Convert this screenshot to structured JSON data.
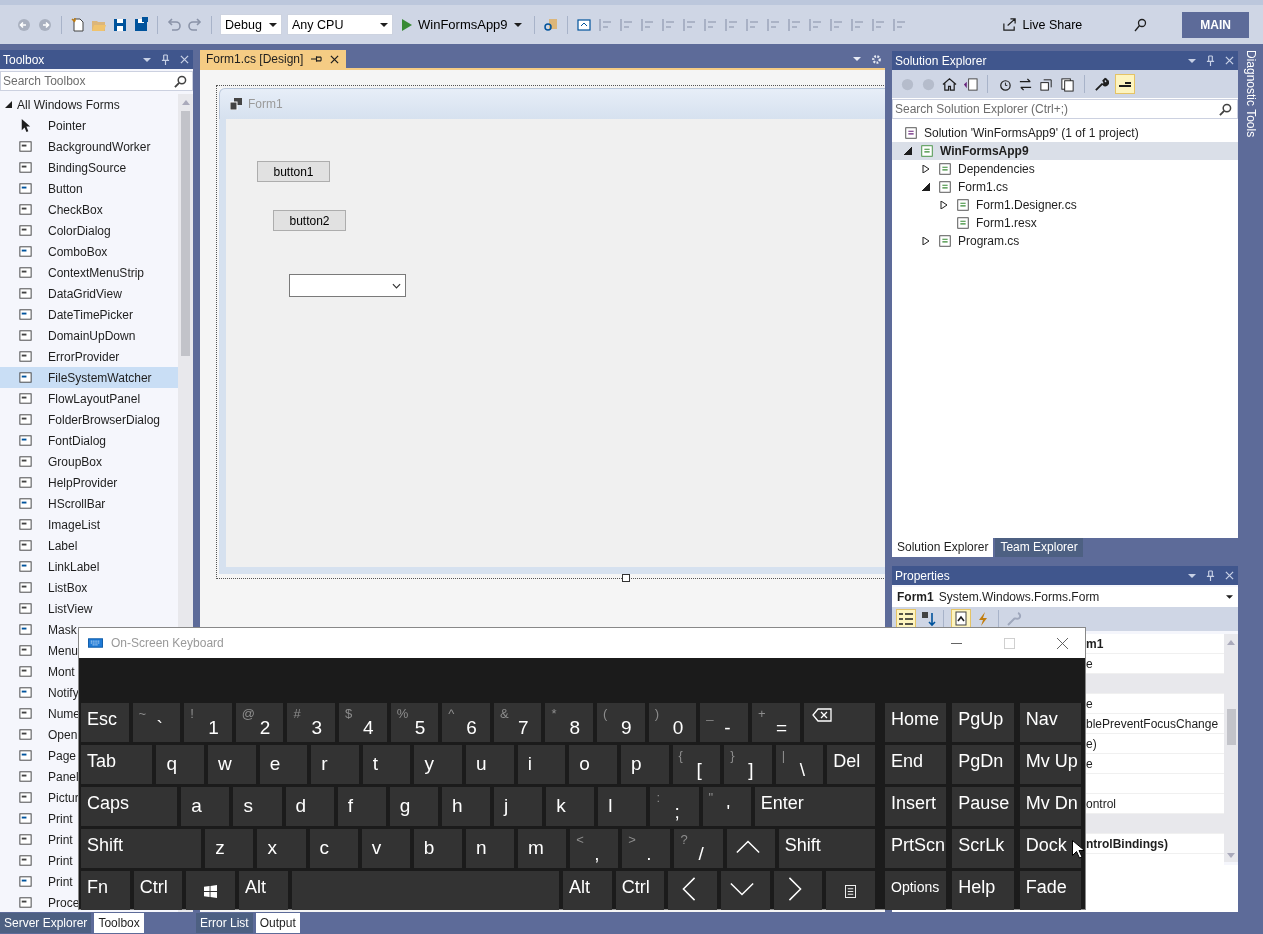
{
  "toolbar": {
    "configuration": "Debug",
    "platform": "Any CPU",
    "start_target": "WinFormsApp9",
    "live_share": "Live Share",
    "branch_badge": "MAIN"
  },
  "toolbox": {
    "title": "Toolbox",
    "search": {
      "placeholder": "Search Toolbox"
    },
    "group": {
      "label": "All Windows Forms",
      "expanded": true
    },
    "items": [
      {
        "label": "Pointer",
        "selected": false
      },
      {
        "label": "BackgroundWorker",
        "selected": false
      },
      {
        "label": "BindingSource",
        "selected": false
      },
      {
        "label": "Button",
        "selected": false
      },
      {
        "label": "CheckBox",
        "selected": false
      },
      {
        "label": "ColorDialog",
        "selected": false
      },
      {
        "label": "ComboBox",
        "selected": false
      },
      {
        "label": "ContextMenuStrip",
        "selected": false
      },
      {
        "label": "DataGridView",
        "selected": false
      },
      {
        "label": "DateTimePicker",
        "selected": false
      },
      {
        "label": "DomainUpDown",
        "selected": false
      },
      {
        "label": "ErrorProvider",
        "selected": false
      },
      {
        "label": "FileSystemWatcher",
        "selected": true
      },
      {
        "label": "FlowLayoutPanel",
        "selected": false
      },
      {
        "label": "FolderBrowserDialog",
        "selected": false
      },
      {
        "label": "FontDialog",
        "selected": false
      },
      {
        "label": "GroupBox",
        "selected": false
      },
      {
        "label": "HelpProvider",
        "selected": false
      },
      {
        "label": "HScrollBar",
        "selected": false
      },
      {
        "label": "ImageList",
        "selected": false
      },
      {
        "label": "Label",
        "selected": false
      },
      {
        "label": "LinkLabel",
        "selected": false
      },
      {
        "label": "ListBox",
        "selected": false
      },
      {
        "label": "ListView",
        "selected": false
      },
      {
        "label": "Mask",
        "selected": false
      },
      {
        "label": "Menu",
        "selected": false
      },
      {
        "label": "Mont",
        "selected": false
      },
      {
        "label": "Notify",
        "selected": false
      },
      {
        "label": "Nume",
        "selected": false
      },
      {
        "label": "Open",
        "selected": false
      },
      {
        "label": "Page",
        "selected": false
      },
      {
        "label": "Panel",
        "selected": false
      },
      {
        "label": "Pictur",
        "selected": false
      },
      {
        "label": "Print",
        "selected": false
      },
      {
        "label": "Print",
        "selected": false
      },
      {
        "label": "Print",
        "selected": false
      },
      {
        "label": "Print",
        "selected": false
      },
      {
        "label": "Proce",
        "selected": false
      }
    ]
  },
  "editor": {
    "tabs": [
      {
        "label": "Form1.cs [Design]",
        "selected": true
      }
    ],
    "form": {
      "title": "Form1",
      "controls": [
        {
          "kind": "button",
          "text": "button1"
        },
        {
          "kind": "button",
          "text": "button2"
        },
        {
          "kind": "combobox"
        }
      ]
    }
  },
  "solution_explorer": {
    "title": "Solution Explorer",
    "search": {
      "placeholder": "Search Solution Explorer (Ctrl+;)"
    },
    "tree": [
      {
        "label": "Solution 'WinFormsApp9' (1 of 1 project)",
        "selected": false,
        "bold": false,
        "children": [
          {
            "label": "WinFormsApp9",
            "selected": true,
            "bold": true,
            "expanded": true,
            "children": [
              {
                "label": "Dependencies",
                "selected": false,
                "bold": false,
                "expanded": false
              },
              {
                "label": "Form1.cs",
                "selected": false,
                "bold": false,
                "expanded": true,
                "children": [
                  {
                    "label": "Form1.Designer.cs",
                    "selected": false,
                    "bold": false,
                    "expanded": false
                  },
                  {
                    "label": "Form1.resx",
                    "selected": false,
                    "bold": false
                  }
                ]
              },
              {
                "label": "Program.cs",
                "selected": false,
                "bold": false,
                "expanded": false
              }
            ]
          }
        ]
      }
    ],
    "tabs": [
      {
        "label": "Solution Explorer",
        "selected": true
      },
      {
        "label": "Team Explorer",
        "selected": false
      }
    ]
  },
  "diagnostic_tools": {
    "label": "Diagnostic Tools"
  },
  "properties": {
    "title": "Properties",
    "object_name": "Form1",
    "object_type": "System.Windows.Forms.Form",
    "rows": [
      {
        "kind": "property",
        "value": "m1",
        "bold": true
      },
      {
        "kind": "property",
        "value": "e",
        "bold": false
      },
      {
        "kind": "category"
      },
      {
        "kind": "property",
        "value": "e",
        "bold": false
      },
      {
        "kind": "property",
        "value": "blePreventFocusChange",
        "bold": false
      },
      {
        "kind": "property",
        "value": "e)",
        "bold": false
      },
      {
        "kind": "property",
        "value": "e",
        "bold": false
      },
      {
        "kind": "property"
      },
      {
        "kind": "property",
        "value": "ontrol",
        "bold": false
      },
      {
        "kind": "category"
      },
      {
        "kind": "property",
        "value": "ntrolBindings)",
        "bold": true
      },
      {
        "kind": "property"
      }
    ]
  },
  "keyboard": {
    "title": "On-Screen Keyboard",
    "main_rows": [
      [
        {
          "kind": "label",
          "label": "Esc"
        },
        {
          "kind": "char",
          "shift": "~",
          "label": "`"
        },
        {
          "kind": "char",
          "shift": "!",
          "label": "1"
        },
        {
          "kind": "char",
          "shift": "@",
          "label": "2"
        },
        {
          "kind": "char",
          "shift": "#",
          "label": "3"
        },
        {
          "kind": "char",
          "shift": "$",
          "label": "4"
        },
        {
          "kind": "char",
          "shift": "%",
          "label": "5"
        },
        {
          "kind": "char",
          "shift": "^",
          "label": "6"
        },
        {
          "kind": "char",
          "shift": "&",
          "label": "7"
        },
        {
          "kind": "char",
          "shift": "*",
          "label": "8"
        },
        {
          "kind": "char",
          "shift": "(",
          "label": "9"
        },
        {
          "kind": "char",
          "shift": ")",
          "label": "0"
        },
        {
          "kind": "char",
          "shift": "_",
          "label": "-"
        },
        {
          "kind": "char",
          "shift": "+",
          "label": "="
        },
        {
          "kind": "backspace"
        }
      ],
      [
        {
          "kind": "label",
          "label": "Tab"
        },
        {
          "kind": "letter",
          "label": "q"
        },
        {
          "kind": "letter",
          "label": "w"
        },
        {
          "kind": "letter",
          "label": "e"
        },
        {
          "kind": "letter",
          "label": "r"
        },
        {
          "kind": "letter",
          "label": "t"
        },
        {
          "kind": "letter",
          "label": "y"
        },
        {
          "kind": "letter",
          "label": "u"
        },
        {
          "kind": "letter",
          "label": "i"
        },
        {
          "kind": "letter",
          "label": "o"
        },
        {
          "kind": "letter",
          "label": "p"
        },
        {
          "kind": "char",
          "shift": "{",
          "label": "["
        },
        {
          "kind": "char",
          "shift": "}",
          "label": "]"
        },
        {
          "kind": "char",
          "shift": "|",
          "label": "\\"
        },
        {
          "kind": "label",
          "label": "Del"
        }
      ],
      [
        {
          "kind": "label",
          "label": "Caps"
        },
        {
          "kind": "letter",
          "label": "a"
        },
        {
          "kind": "letter",
          "label": "s"
        },
        {
          "kind": "letter",
          "label": "d"
        },
        {
          "kind": "letter",
          "label": "f"
        },
        {
          "kind": "letter",
          "label": "g"
        },
        {
          "kind": "letter",
          "label": "h"
        },
        {
          "kind": "letter",
          "label": "j"
        },
        {
          "kind": "letter",
          "label": "k"
        },
        {
          "kind": "letter",
          "label": "l"
        },
        {
          "kind": "char",
          "shift": ":",
          "label": ";"
        },
        {
          "kind": "char",
          "shift": "\"",
          "label": "'"
        },
        {
          "kind": "label",
          "label": "Enter"
        }
      ],
      [
        {
          "kind": "label",
          "label": "Shift"
        },
        {
          "kind": "letter",
          "label": "z"
        },
        {
          "kind": "letter",
          "label": "x"
        },
        {
          "kind": "letter",
          "label": "c"
        },
        {
          "kind": "letter",
          "label": "v"
        },
        {
          "kind": "letter",
          "label": "b"
        },
        {
          "kind": "letter",
          "label": "n"
        },
        {
          "kind": "letter",
          "label": "m"
        },
        {
          "kind": "char",
          "shift": "<",
          "label": ","
        },
        {
          "kind": "char",
          "shift": ">",
          "label": "."
        },
        {
          "kind": "char",
          "shift": "?",
          "label": "/"
        },
        {
          "kind": "up"
        },
        {
          "kind": "label",
          "label": "Shift"
        }
      ],
      [
        {
          "kind": "label",
          "label": "Fn"
        },
        {
          "kind": "label",
          "label": "Ctrl"
        },
        {
          "kind": "windows"
        },
        {
          "kind": "label",
          "label": "Alt"
        },
        {
          "kind": "space"
        },
        {
          "kind": "label",
          "label": "Alt"
        },
        {
          "kind": "label",
          "label": "Ctrl"
        },
        {
          "kind": "left"
        },
        {
          "kind": "down"
        },
        {
          "kind": "right"
        },
        {
          "kind": "menu"
        }
      ]
    ],
    "nav_rows": [
      [
        {
          "kind": "label",
          "label": "Home"
        },
        {
          "kind": "label",
          "label": "PgUp"
        },
        {
          "kind": "label",
          "label": "Nav"
        }
      ],
      [
        {
          "kind": "label",
          "label": "End"
        },
        {
          "kind": "label",
          "label": "PgDn"
        },
        {
          "kind": "label",
          "label": "Mv Up"
        }
      ],
      [
        {
          "kind": "label",
          "label": "Insert"
        },
        {
          "kind": "label",
          "label": "Pause"
        },
        {
          "kind": "label",
          "label": "Mv Dn"
        }
      ],
      [
        {
          "kind": "label",
          "label": "PrtScn"
        },
        {
          "kind": "label",
          "label": "ScrLk"
        },
        {
          "kind": "label",
          "label": "Dock"
        }
      ],
      [
        {
          "kind": "label",
          "label": "Options"
        },
        {
          "kind": "label",
          "label": "Help"
        },
        {
          "kind": "label",
          "label": "Fade"
        }
      ]
    ]
  },
  "bottom_tabs": {
    "left": [
      {
        "label": "Server Explorer",
        "selected": false
      },
      {
        "label": "Toolbox",
        "selected": true
      }
    ],
    "center": [
      {
        "label": "Error List",
        "selected": false
      },
      {
        "label": "Output",
        "selected": true
      }
    ]
  }
}
